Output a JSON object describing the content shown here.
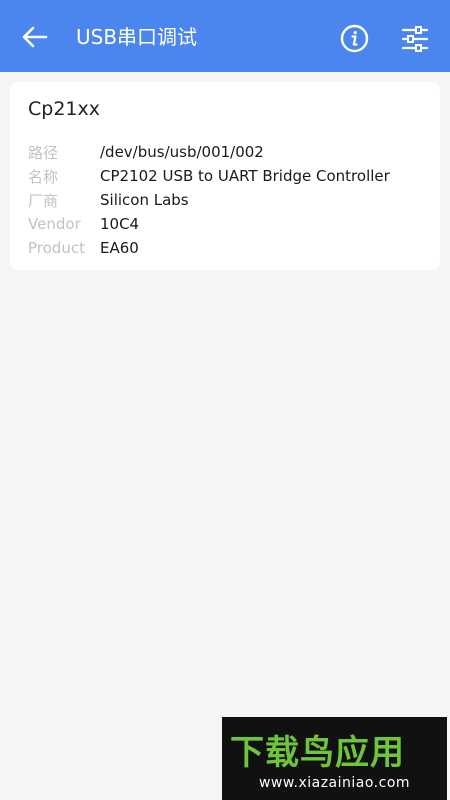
{
  "appbar": {
    "title": "USB串口调试",
    "back_icon": "arrow-left-icon",
    "info_icon": "info-icon",
    "settings_icon": "sliders-icon",
    "color": "#4a86ee"
  },
  "device": {
    "name": "Cp21xx",
    "rows": [
      {
        "label": "路径",
        "value": "/dev/bus/usb/001/002"
      },
      {
        "label": "名称",
        "value": "CP2102 USB to UART Bridge Controller"
      },
      {
        "label": "厂商",
        "value": "Silicon Labs"
      },
      {
        "label": "Vendor",
        "value": "10C4"
      },
      {
        "label": "Product",
        "value": "EA60"
      }
    ]
  },
  "watermark": {
    "brand": "下载鸟应用",
    "url": "www.xiazainiao.com"
  }
}
